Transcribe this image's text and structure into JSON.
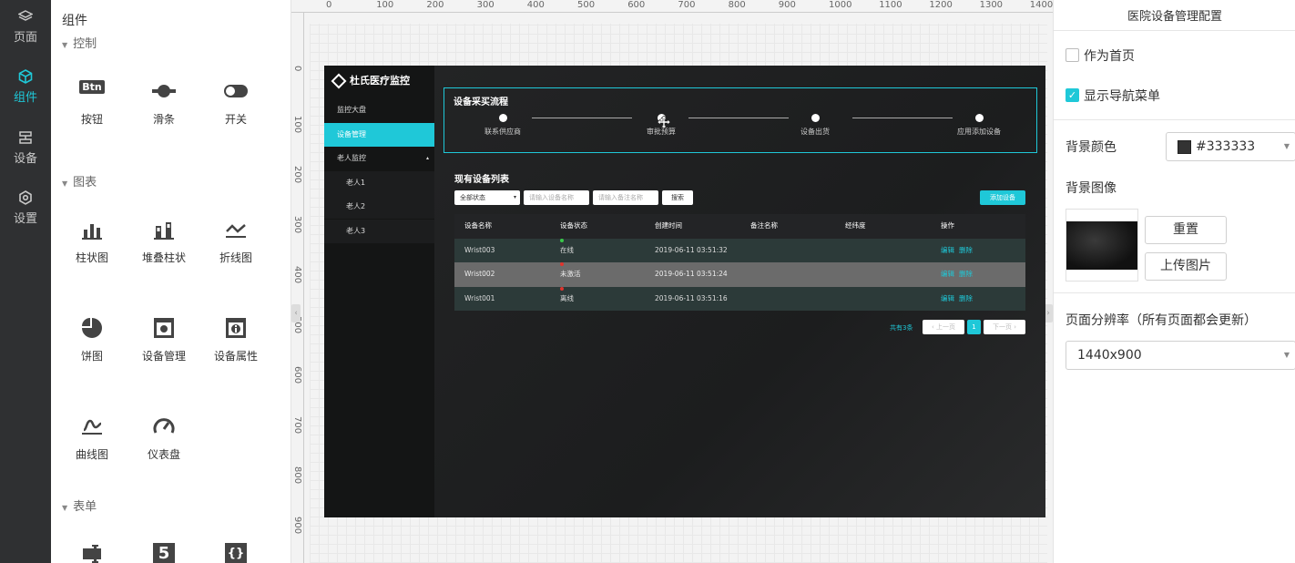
{
  "nav": {
    "items": [
      {
        "label": "页面",
        "icon": "layers-icon"
      },
      {
        "label": "组件",
        "icon": "cube-icon"
      },
      {
        "label": "设备",
        "icon": "device-icon"
      },
      {
        "label": "设置",
        "icon": "gear-icon"
      }
    ],
    "active_index": 1,
    "active_color": "#1fc8d8"
  },
  "panel": {
    "title": "组件",
    "sections": [
      {
        "label": "控制",
        "items": [
          {
            "label": "按钮",
            "icon": "button-icon",
            "glyph": "Btn"
          },
          {
            "label": "滑条",
            "icon": "slider-icon"
          },
          {
            "label": "开关",
            "icon": "toggle-icon"
          }
        ]
      },
      {
        "label": "图表",
        "items": [
          {
            "label": "柱状图",
            "icon": "bar-chart-icon"
          },
          {
            "label": "堆叠柱状",
            "icon": "stacked-bar-icon"
          },
          {
            "label": "折线图",
            "icon": "line-chart-icon"
          },
          {
            "label": "饼图",
            "icon": "pie-chart-icon"
          },
          {
            "label": "设备管理",
            "icon": "device-manage-icon"
          },
          {
            "label": "设备属性",
            "icon": "device-info-icon"
          },
          {
            "label": "曲线图",
            "icon": "curve-chart-icon"
          },
          {
            "label": "仪表盘",
            "icon": "gauge-icon"
          }
        ]
      },
      {
        "label": "表单",
        "items": [
          {
            "label": "",
            "icon": "form-input-icon"
          },
          {
            "label": "",
            "icon": "number-icon",
            "glyph": "5"
          },
          {
            "label": "",
            "icon": "json-icon",
            "glyph": "{}"
          }
        ]
      }
    ]
  },
  "canvas": {
    "ruler_top": [
      "0",
      "100",
      "200",
      "300",
      "400",
      "500",
      "600",
      "700",
      "800",
      "900",
      "1000",
      "1100",
      "1200",
      "1300",
      "1400"
    ],
    "ruler_left": [
      "0",
      "100",
      "200",
      "300",
      "400",
      "500",
      "600",
      "700",
      "800",
      "900"
    ],
    "preview": {
      "brand": "杜氏医疗监控",
      "menu": [
        {
          "label": "监控大盘",
          "active": false,
          "sub": false
        },
        {
          "label": "设备管理",
          "active": true,
          "sub": false
        },
        {
          "label": "老人监控",
          "active": false,
          "sub": false,
          "expand": "▴"
        },
        {
          "label": "老人1",
          "active": false,
          "sub": true
        },
        {
          "label": "老人2",
          "active": false,
          "sub": true
        },
        {
          "label": "老人3",
          "active": false,
          "sub": true
        }
      ],
      "flow": {
        "title": "设备采买流程",
        "steps": [
          "联系供应商",
          "审批预算",
          "设备出货",
          "应用添加设备"
        ]
      },
      "list": {
        "title": "现有设备列表",
        "status_select": "全部状态",
        "name_placeholder": "请输入设备名称",
        "remark_placeholder": "请输入备注名称",
        "search_label": "搜索",
        "add_label": "添加设备",
        "columns": [
          "设备名称",
          "设备状态",
          "创建时间",
          "备注名称",
          "经纬度",
          "操作"
        ],
        "rows": [
          {
            "name": "Wrist003",
            "status": "在线",
            "status_color": "#3ac84a",
            "created": "2019-06-11 03:51:32",
            "remark": "",
            "coords": "",
            "edit": "编辑",
            "delete": "删除"
          },
          {
            "name": "Wrist002",
            "status": "未激活",
            "status_color": "#e0342d",
            "created": "2019-06-11 03:51:24",
            "remark": "",
            "coords": "",
            "edit": "编辑",
            "delete": "删除"
          },
          {
            "name": "Wrist001",
            "status": "离线",
            "status_color": "#e0342d",
            "created": "2019-06-11 03:51:16",
            "remark": "",
            "coords": "",
            "edit": "编辑",
            "delete": "删除"
          }
        ],
        "total": "共有3条",
        "prev": "上一页",
        "page": "1",
        "next": "下一页"
      }
    }
  },
  "config": {
    "title": "医院设备管理配置",
    "as_home_label": "作为首页",
    "as_home_checked": false,
    "show_nav_label": "显示导航菜单",
    "show_nav_checked": true,
    "bg_color_label": "背景颜色",
    "bg_color_value": "#333333",
    "bg_image_label": "背景图像",
    "reset_label": "重置",
    "upload_label": "上传图片",
    "resolution_label": "页面分辨率（所有页面都会更新）",
    "resolution_value": "1440x900"
  }
}
